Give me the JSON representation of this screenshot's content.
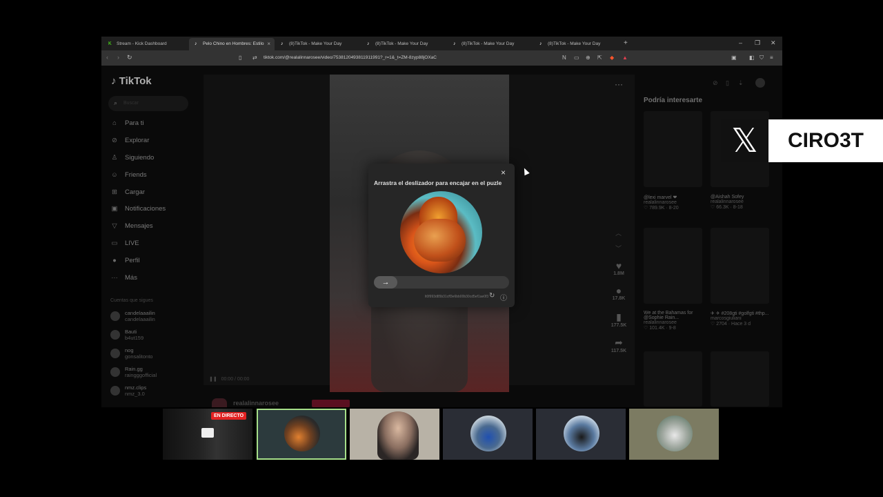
{
  "browser": {
    "tabs": [
      {
        "title": "Stream - Kick Dashboard",
        "icon": "K",
        "active": false
      },
      {
        "title": "Pelo Chino en Hombres: Estilo",
        "icon": "♪",
        "active": true
      },
      {
        "title": "(8)TikTok - Make Your Day",
        "icon": "♪",
        "active": false
      },
      {
        "title": "(8)TikTok - Make Your Day",
        "icon": "♪",
        "active": false
      },
      {
        "title": "(8)TikTok - Make Your Day",
        "icon": "♪",
        "active": false
      },
      {
        "title": "(8)TikTok - Make Your Day",
        "icon": "♪",
        "active": false
      }
    ],
    "url": "tiktok.com/@realalinnarosee/video/7538120493811911991?_r=1&_t=ZM-8zyp88jOXaC"
  },
  "tiktok": {
    "logo": "TikTok",
    "search_placeholder": "Buscar",
    "nav": [
      {
        "icon": "⌂",
        "label": "Para ti"
      },
      {
        "icon": "⊘",
        "label": "Explorar"
      },
      {
        "icon": "♙",
        "label": "Siguiendo"
      },
      {
        "icon": "☺",
        "label": "Friends"
      },
      {
        "icon": "⊞",
        "label": "Cargar"
      },
      {
        "icon": "▣",
        "label": "Notificaciones"
      },
      {
        "icon": "▽",
        "label": "Mensajes"
      },
      {
        "icon": "▭",
        "label": "LIVE"
      },
      {
        "icon": "●",
        "label": "Perfil"
      },
      {
        "icon": "···",
        "label": "Más"
      }
    ],
    "following_title": "Cuentas que sigues",
    "following": [
      {
        "name": "candelaaailin",
        "handle": "candelaaailin"
      },
      {
        "name": "Bauti",
        "handle": "b4ut159"
      },
      {
        "name": "nog",
        "handle": "gonsalitonto"
      },
      {
        "name": "Rain.gg",
        "handle": "raingggofficial"
      },
      {
        "name": "nmz.clips",
        "handle": "nmz_3.0"
      }
    ],
    "video_time": "00:00 / 00:00",
    "actions": [
      {
        "icon": "♥",
        "count": "1.8M"
      },
      {
        "icon": "●",
        "count": "17.8K"
      },
      {
        "icon": "▮",
        "count": "177.5K"
      },
      {
        "icon": "➦",
        "count": "117.5K"
      }
    ],
    "recommend_title": "Podría interesarte",
    "recommended": [
      {
        "title": "@lexi marvel ❤",
        "author": "realalinnarosee",
        "stats": "♡ 789.9K · 8-20"
      },
      {
        "title": "@Aishah Sofey",
        "author": "realalinnarosee",
        "stats": "♡ 66.3K · 8-18"
      },
      {
        "title": "We at the Bahamas for @Sophie Rain...",
        "author": "realalinnarosee",
        "stats": "♡ 101.4K · 9-8"
      },
      {
        "title": "✈ ✈ #208gti #golfgti #thp...",
        "author": "marcosgiuliani",
        "stats": "♡ 2704 · Hace 3 d"
      }
    ],
    "creator_handle": "realalinnarosee"
  },
  "captcha": {
    "title": "Arrastra el deslizador para encajar en el puzle",
    "close": "×",
    "slider_icon": "→",
    "id_text": "lt0f993d85b31cff3e6bb00b30cd5ef1ae0f3",
    "refresh_icon": "↻",
    "info_icon": "ⓘ"
  },
  "overlay": {
    "x_logo": "𝕏",
    "handle": "CIRO3T",
    "live_badge": "EN DIRECTO"
  },
  "colors": {
    "live": "#e32222",
    "selected_thumb_border": "#a7e08a"
  }
}
